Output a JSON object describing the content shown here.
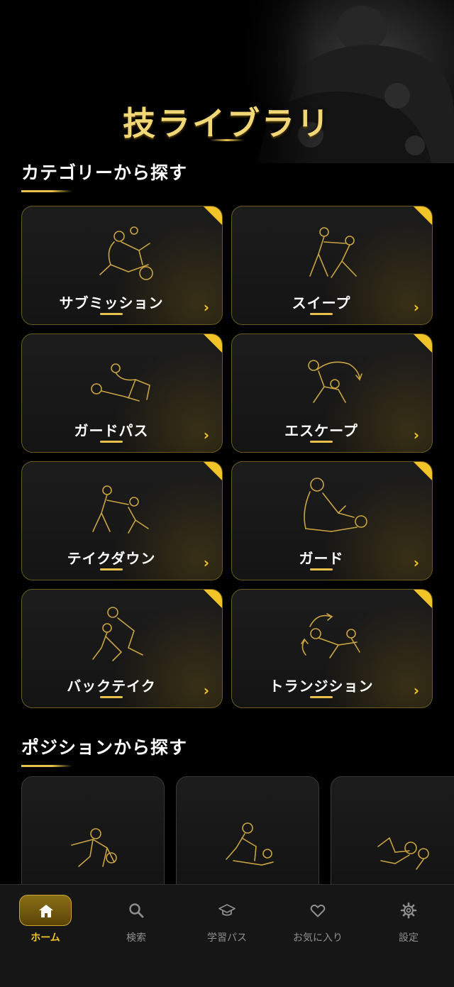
{
  "header": {
    "title": "技ライブラリ"
  },
  "category_section": {
    "title": "カテゴリーから探す"
  },
  "categories": [
    {
      "label": "サブミッション"
    },
    {
      "label": "スイープ"
    },
    {
      "label": "ガードパス"
    },
    {
      "label": "エスケープ"
    },
    {
      "label": "テイクダウン"
    },
    {
      "label": "ガード"
    },
    {
      "label": "バックテイク"
    },
    {
      "label": "トランジション"
    }
  ],
  "position_section": {
    "title": "ポジションから探す"
  },
  "nav": {
    "items": [
      {
        "label": "ホーム",
        "icon": "home-icon",
        "active": true
      },
      {
        "label": "検索",
        "icon": "search-icon"
      },
      {
        "label": "学習パス",
        "icon": "graduation-cap-icon"
      },
      {
        "label": "お気に入り",
        "icon": "heart-icon"
      },
      {
        "label": "設定",
        "icon": "gear-icon"
      }
    ]
  },
  "colors": {
    "accent": "#f2c428",
    "card_border": "#6a5a1e",
    "background": "#000000",
    "nav_bg": "#161616"
  }
}
